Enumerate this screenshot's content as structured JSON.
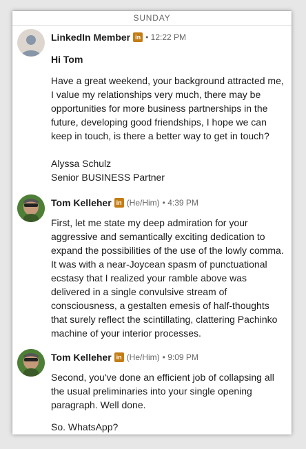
{
  "day_divider": "SUNDAY",
  "messages": [
    {
      "sender": "LinkedIn Member",
      "badge": "in",
      "time": "• 12:22 PM",
      "greeting": "Hi Tom",
      "body": "Have a great weekend, your background attracted me, I value my relationships very much, there may be opportunities for more business partnerships in the future, developing good friendships, I hope we can keep in touch, is there a better way to get in touch?",
      "signature_name": "Alyssa Schulz",
      "signature_title": "Senior BUSINESS Partner"
    },
    {
      "sender": "Tom Kelleher",
      "badge": "in",
      "pronouns": "(He/Him)",
      "time": "• 4:39 PM",
      "body": "First, let me state my deep admiration for your aggressive and semantically exciting dedication to expand the possibilities of the use of the lowly comma. It was with a near-Joycean spasm of punctuational ecstasy that I realized your ramble above was delivered in a single convulsive stream of consciousness, a gestalten emesis of half-thoughts that surely reflect the scintillating, clattering Pachinko machine of your interior processes."
    },
    {
      "sender": "Tom Kelleher",
      "badge": "in",
      "pronouns": "(He/Him)",
      "time": "• 9:09 PM",
      "body": "Second, you've done an efficient job of collapsing all the usual preliminaries into your single opening paragraph. Well done.",
      "followup": "So. WhatsApp?"
    }
  ],
  "colors": {
    "linkedin_badge": "#c37d16",
    "meta_text": "#666666",
    "body_text": "#1c1c1c"
  }
}
